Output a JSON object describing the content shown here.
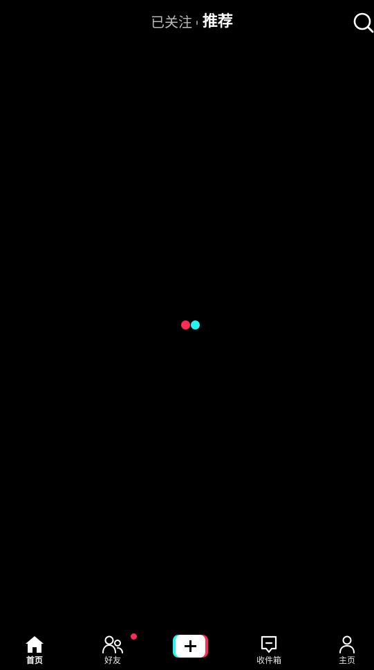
{
  "header": {
    "tabs": [
      {
        "label": "已关注",
        "active": false
      },
      {
        "label": "推荐",
        "active": true
      }
    ],
    "search_icon": "search-icon"
  },
  "loader": {
    "colors": [
      "#fe2c55",
      "#25f4ee"
    ]
  },
  "bottom_nav": {
    "items": [
      {
        "label": "首页",
        "icon": "home-icon",
        "active": true
      },
      {
        "label": "好友",
        "icon": "friends-icon",
        "active": false,
        "badge": true
      },
      {
        "label": "",
        "icon": "plus-icon",
        "active": false
      },
      {
        "label": "收件箱",
        "icon": "inbox-icon",
        "active": false
      },
      {
        "label": "主页",
        "icon": "profile-icon",
        "active": false
      }
    ]
  },
  "colors": {
    "background": "#000000",
    "accent_red": "#fe2c55",
    "accent_cyan": "#25f4ee",
    "inactive_tab": "#b9b9b9"
  }
}
